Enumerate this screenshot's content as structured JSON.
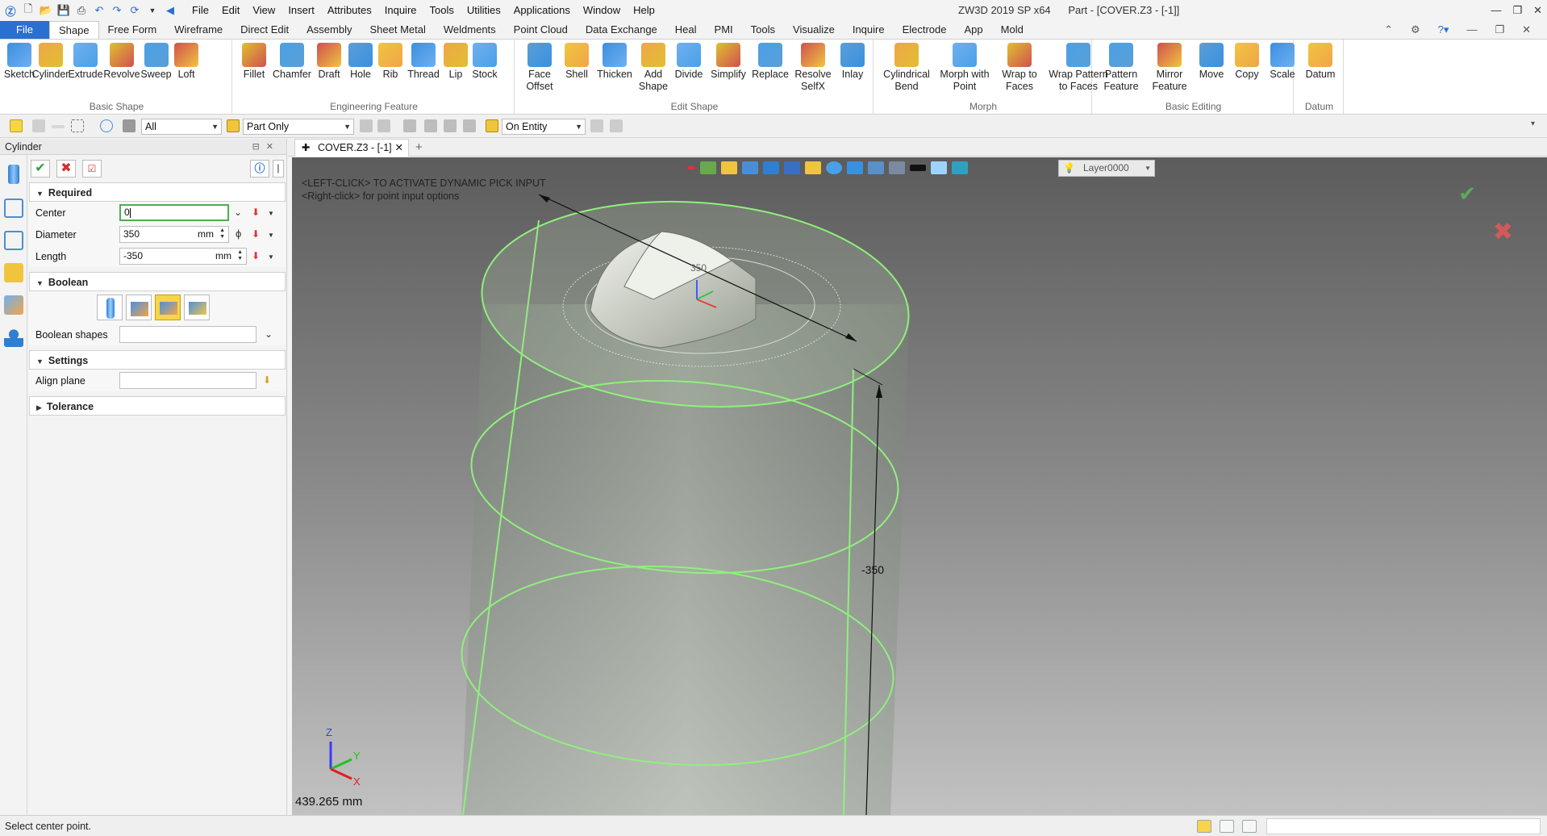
{
  "window": {
    "title": "ZW3D 2019 SP x64",
    "document": "Part - [COVER.Z3 - [-1]]"
  },
  "menu": [
    "File",
    "Edit",
    "View",
    "Insert",
    "Attributes",
    "Inquire",
    "Tools",
    "Utilities",
    "Applications",
    "Window",
    "Help"
  ],
  "ribbon_tabs": [
    "File",
    "Shape",
    "Free Form",
    "Wireframe",
    "Direct Edit",
    "Assembly",
    "Sheet Metal",
    "Weldments",
    "Point Cloud",
    "Data Exchange",
    "Heal",
    "PMI",
    "Tools",
    "Visualize",
    "Inquire",
    "Electrode",
    "App",
    "Mold"
  ],
  "active_tab": "Shape",
  "ribbon_groups": [
    {
      "name": "Basic Shape",
      "buttons": [
        [
          "Sketch",
          ""
        ],
        [
          "Cylinder",
          ""
        ],
        [
          "Extrude",
          ""
        ],
        [
          "Revolve",
          ""
        ],
        [
          "Sweep",
          ""
        ],
        [
          "Loft",
          ""
        ]
      ]
    },
    {
      "name": "Engineering Feature",
      "buttons": [
        [
          "Fillet",
          ""
        ],
        [
          "Chamfer",
          ""
        ],
        [
          "Draft",
          ""
        ],
        [
          "Hole",
          ""
        ],
        [
          "Rib",
          ""
        ],
        [
          "Thread",
          ""
        ],
        [
          "Lip",
          ""
        ],
        [
          "Stock",
          ""
        ]
      ]
    },
    {
      "name": "Edit Shape",
      "buttons": [
        [
          "Face",
          "Offset"
        ],
        [
          "Shell",
          ""
        ],
        [
          "Thicken",
          ""
        ],
        [
          "Add",
          "Shape"
        ],
        [
          "Divide",
          ""
        ],
        [
          "Simplify",
          ""
        ],
        [
          "Replace",
          ""
        ],
        [
          "Resolve",
          "SelfX"
        ],
        [
          "Inlay",
          ""
        ]
      ]
    },
    {
      "name": "Morph",
      "buttons": [
        [
          "Cylindrical",
          "Bend"
        ],
        [
          "Morph with",
          "Point"
        ],
        [
          "Wrap to",
          "Faces"
        ],
        [
          "Wrap Pattern",
          "to Faces"
        ]
      ]
    },
    {
      "name": "Basic Editing",
      "buttons": [
        [
          "Pattern",
          "Feature"
        ],
        [
          "Mirror",
          "Feature"
        ],
        [
          "Move",
          ""
        ],
        [
          "Copy",
          ""
        ],
        [
          "Scale",
          ""
        ]
      ]
    },
    {
      "name": "Datum",
      "buttons": [
        [
          "Datum",
          ""
        ]
      ]
    }
  ],
  "toolbar2": {
    "filter": "All",
    "scope": "Part Only",
    "pick": "On Entity"
  },
  "panel": {
    "title": "Cylinder",
    "sections": {
      "required": "Required",
      "boolean": "Boolean",
      "settings": "Settings",
      "tolerance": "Tolerance"
    },
    "center_label": "Center",
    "center_value": "0",
    "diameter_label": "Diameter",
    "diameter_value": "350",
    "diameter_unit": "mm",
    "length_label": "Length",
    "length_value": "-350",
    "length_unit": "mm",
    "boolean_shapes_label": "Boolean shapes",
    "align_plane_label": "Align plane",
    "diameter_symbol": "ϕ"
  },
  "doc_tab": "COVER.Z3 - [-1]",
  "viewport": {
    "hint1": "<LEFT-CLICK> TO ACTIVATE DYNAMIC PICK INPUT",
    "hint2": "<Right-click> for point input options",
    "readout": "439.265 mm",
    "dim_label": "-350",
    "dim_label_small": "350",
    "layer": "Layer0000",
    "axis_z": "Z",
    "axis_y": "Y",
    "axis_x": "X"
  },
  "status": "Select center point.",
  "colors": {
    "accent": "#2b6fd1",
    "preview_edge": "#8ff07c",
    "focus": "#4caf50"
  }
}
